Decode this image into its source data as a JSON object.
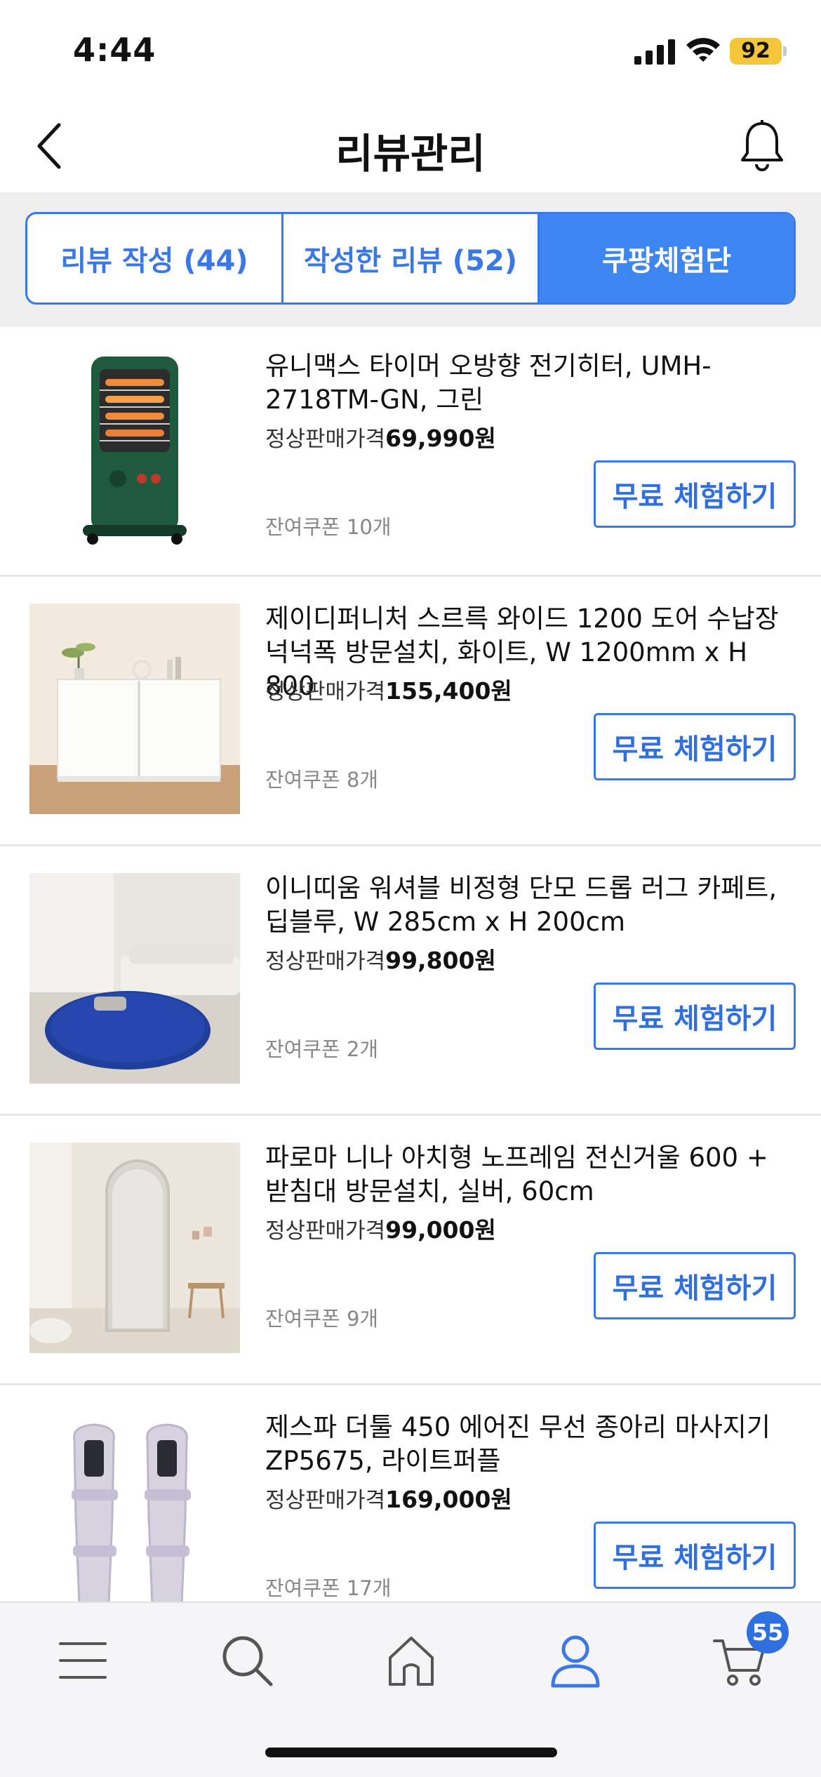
{
  "status_bar": {
    "time": "4:44",
    "battery": "92"
  },
  "header": {
    "title": "리뷰관리"
  },
  "tabs": [
    {
      "label": "리뷰 작성 (44)",
      "active": false
    },
    {
      "label": "작성한 리뷰 (52)",
      "active": false
    },
    {
      "label": "쿠팡체험단",
      "active": true
    }
  ],
  "products": [
    {
      "name": "유니맥스 타이머 오방향 전기히터, UMH-2718TM-GN, 그린",
      "price_label": "정상판매가격",
      "price": "69,990원",
      "coupon": "잔여쿠폰 10개",
      "button": "무료 체험하기"
    },
    {
      "name": "제이디퍼니처 스르륵 와이드 1200 도어 수납장 넉넉폭 방문설치, 화이트, W 1200mm x H 800",
      "price_label": "정상판매가격",
      "price": "155,400원",
      "coupon": "잔여쿠폰 8개",
      "button": "무료 체험하기"
    },
    {
      "name": "이니띠움 워셔블 비정형 단모 드롭 러그 카페트, 딥블루, W 285cm x H 200cm",
      "price_label": "정상판매가격",
      "price": "99,800원",
      "coupon": "잔여쿠폰 2개",
      "button": "무료 체험하기"
    },
    {
      "name": "파로마 니나 아치형 노프레임 전신거울 600 + 받침대 방문설치, 실버, 60cm",
      "price_label": "정상판매가격",
      "price": "99,000원",
      "coupon": "잔여쿠폰 9개",
      "button": "무료 체험하기"
    },
    {
      "name": "제스파 더툴 450 에어진 무선 종아리 마사지기 ZP5675, 라이트퍼플",
      "price_label": "정상판매가격",
      "price": "169,000원",
      "coupon": "잔여쿠폰 17개",
      "button": "무료 체험하기"
    }
  ],
  "bottom_nav": {
    "items": [
      "menu-icon",
      "search-icon",
      "home-icon",
      "my-page-icon",
      "cart-icon"
    ],
    "cart_count": "55"
  },
  "colors": {
    "accent": "#3a78e6",
    "active_tab": "#3d86f2",
    "battery": "#f5c63a"
  }
}
